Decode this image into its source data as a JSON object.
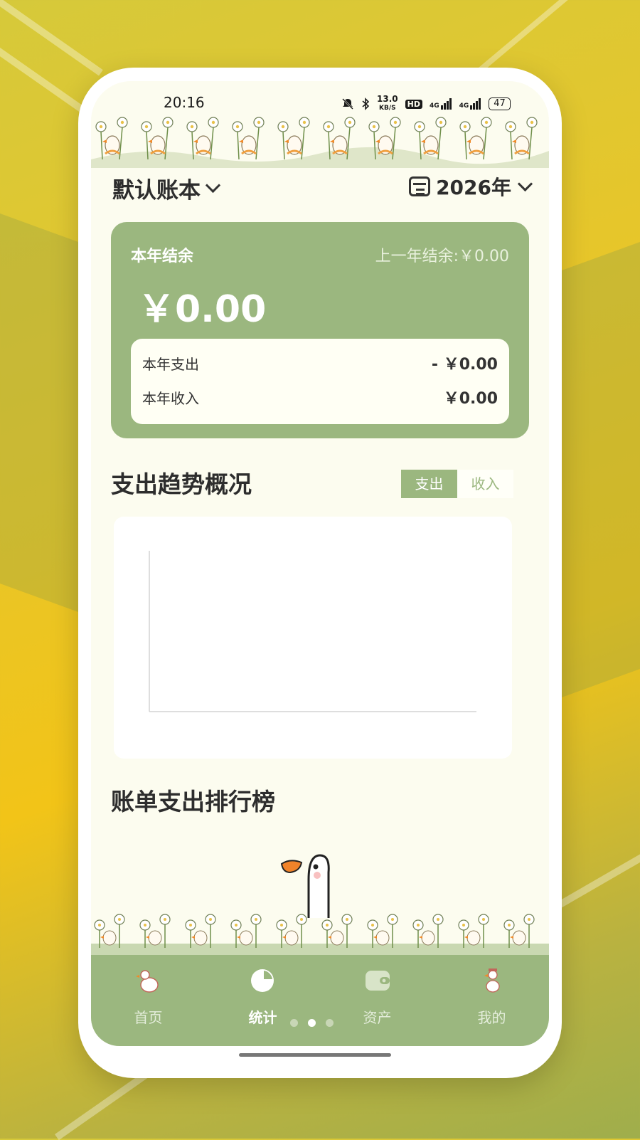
{
  "status_bar": {
    "time": "20:16",
    "net_speed": "13.0",
    "net_unit": "KB/S",
    "hd": "HD",
    "sig1": "4G",
    "sig2": "4G",
    "battery": "47"
  },
  "header": {
    "book_name": "默认账本",
    "year": "2026年"
  },
  "summary": {
    "title": "本年结余",
    "prev_label": "上一年结余:",
    "prev_value": "￥0.00",
    "amount": "￥0.00",
    "expense_label": "本年支出",
    "expense_value": "- ￥0.00",
    "income_label": "本年收入",
    "income_value": "￥0.00"
  },
  "trend": {
    "title": "支出趋势概况",
    "toggle_expense": "支出",
    "toggle_income": "收入",
    "active": "支出"
  },
  "ranking": {
    "title": "账单支出排行榜"
  },
  "tabs": [
    {
      "label": "首页",
      "icon": "goose-home-icon",
      "active": false
    },
    {
      "label": "统计",
      "icon": "pie-chart-icon",
      "active": true
    },
    {
      "label": "资产",
      "icon": "wallet-icon",
      "active": false
    },
    {
      "label": "我的",
      "icon": "goose-profile-icon",
      "active": false
    }
  ],
  "colors": {
    "accent": "#9bb77f",
    "screen_bg": "#fcfcef"
  }
}
